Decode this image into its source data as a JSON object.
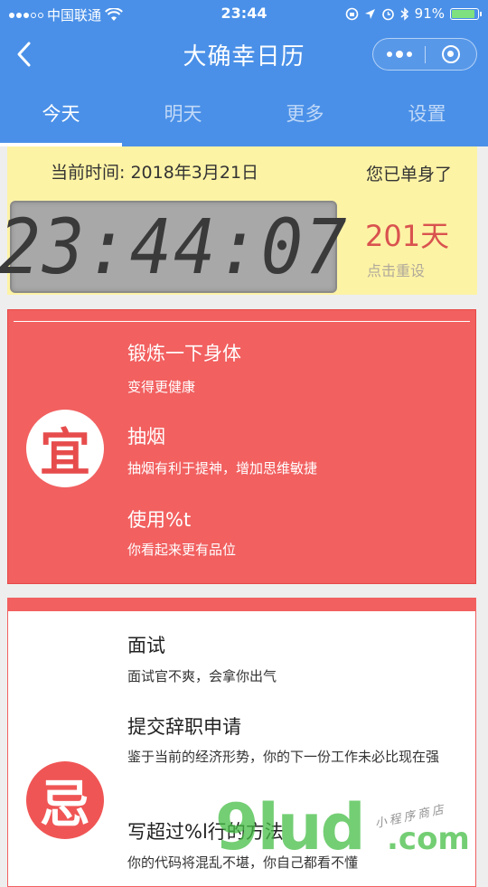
{
  "status_bar": {
    "carrier": "中国联通",
    "time": "23:44",
    "battery_percent": "91%",
    "battery_level": 0.91
  },
  "nav": {
    "title": "大确幸日历"
  },
  "tabs": [
    {
      "label": "今天",
      "active": true
    },
    {
      "label": "明天",
      "active": false
    },
    {
      "label": "更多",
      "active": false
    },
    {
      "label": "设置",
      "active": false
    }
  ],
  "today": {
    "current_time_label": "当前时间: 2018年3月21日",
    "single_label": "您已单身了",
    "clock": "23:44:07",
    "days": "201天",
    "reset": "点击重设"
  },
  "good": {
    "badge": "宜",
    "items": [
      {
        "title": "锻炼一下身体",
        "desc": "变得更健康"
      },
      {
        "title": "抽烟",
        "desc": "抽烟有利于提神，增加思维敏捷"
      },
      {
        "title": "使用%t",
        "desc": "你看起来更有品位"
      }
    ]
  },
  "bad": {
    "badge": "忌",
    "items": [
      {
        "title": "面试",
        "desc": "面试官不爽，会拿你出气"
      },
      {
        "title": "提交辞职申请",
        "desc": "鉴于当前的经济形势，你的下一份工作未必比现在强"
      },
      {
        "title": "写超过%l行的方法",
        "desc": "你的代码将混乱不堪，你自己都看不懂"
      }
    ]
  },
  "watermark": {
    "main": "9lud",
    "domain": ".com",
    "store": "小程序商店"
  },
  "colors": {
    "nav_blue": "#4a90e8",
    "good_red": "#f26060",
    "panel_yellow": "#fdf3a5",
    "days_red": "#d9534f"
  }
}
